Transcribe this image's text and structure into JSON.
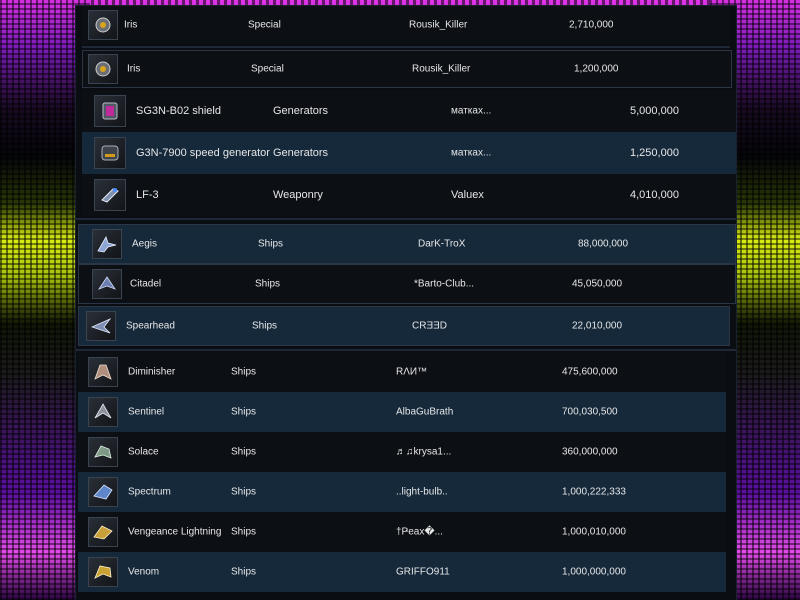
{
  "listings": [
    {
      "name": "Iris",
      "category": "Special",
      "seller": "Rousik_Killer",
      "price": "2,710,000",
      "icon": "drone-icon"
    },
    {
      "name": "Iris",
      "category": "Special",
      "seller": "Rousik_Killer",
      "price": "1,200,000",
      "icon": "drone-icon"
    },
    {
      "name": "SG3N-B02 shield",
      "category": "Generators",
      "seller": "матках...",
      "price": "5,000,000",
      "icon": "shield-generator-icon"
    },
    {
      "name": "G3N-7900 speed generator",
      "category": "Generators",
      "seller": "матках...",
      "price": "1,250,000",
      "icon": "speed-generator-icon"
    },
    {
      "name": "LF-3",
      "category": "Weaponry",
      "seller": "Valuex",
      "price": "4,010,000",
      "icon": "laser-cannon-icon"
    },
    {
      "name": "Aegis",
      "category": "Ships",
      "seller": "DarK-TroX",
      "price": "88,000,000",
      "icon": "ship-icon"
    },
    {
      "name": "Citadel",
      "category": "Ships",
      "seller": "*Barto-Club...",
      "price": "45,050,000",
      "icon": "ship-icon"
    },
    {
      "name": "Spearhead",
      "category": "Ships",
      "seller": "CRƎƎD",
      "price": "22,010,000",
      "icon": "ship-icon"
    },
    {
      "name": "Diminisher",
      "category": "Ships",
      "seller": "RΛИ™",
      "price": "475,600,000",
      "icon": "ship-icon"
    },
    {
      "name": "Sentinel",
      "category": "Ships",
      "seller": "AlbaGuBrath",
      "price": "700,030,500",
      "icon": "ship-icon"
    },
    {
      "name": "Solace",
      "category": "Ships",
      "seller": "♬♫krysa1...",
      "price": "360,000,000",
      "icon": "ship-icon"
    },
    {
      "name": "Spectrum",
      "category": "Ships",
      "seller": "..light-bulb..",
      "price": "1,000,222,333",
      "icon": "ship-icon"
    },
    {
      "name": "Vengeance Lightning",
      "category": "Ships",
      "seller": "†Ҏeax�...",
      "price": "1,000,010,000",
      "icon": "ship-icon"
    },
    {
      "name": "Venom",
      "category": "Ships",
      "seller": "GRIFFO911",
      "price": "1,000,000,000",
      "icon": "ship-icon"
    }
  ],
  "colors": {
    "row_dark": "#0c0f14",
    "row_light": "#16293b",
    "text": "#e6e6e6",
    "border": "#2a3546"
  }
}
